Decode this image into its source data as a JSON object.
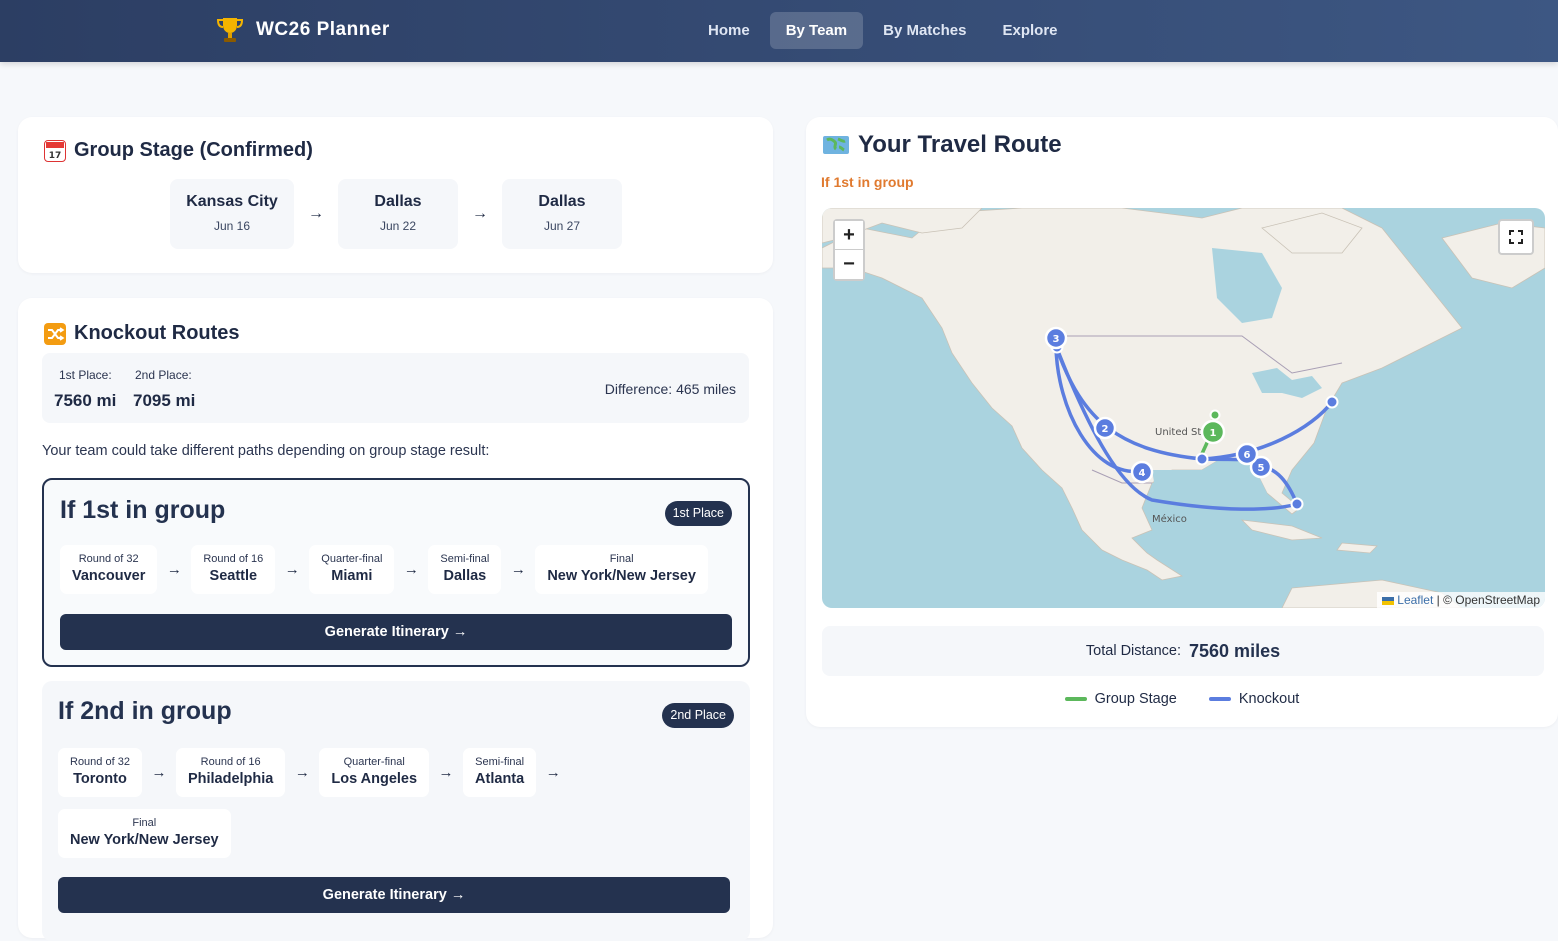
{
  "app": {
    "name": "WC26 Planner"
  },
  "nav": {
    "items": [
      "Home",
      "By Team",
      "By Matches",
      "Explore"
    ],
    "active": "By Team"
  },
  "group_stage": {
    "title": "Group Stage (Confirmed)",
    "venues": [
      {
        "city": "Kansas City",
        "date": "Jun 16"
      },
      {
        "city": "Dallas",
        "date": "Jun 22"
      },
      {
        "city": "Dallas",
        "date": "Jun 27"
      }
    ]
  },
  "knockout": {
    "title": "Knockout Routes",
    "first_label": "1st Place:",
    "first_value": "7560 mi",
    "second_label": "2nd Place:",
    "second_value": "7095 mi",
    "difference": "Difference: 465 miles",
    "intro": "Your team could take different paths depending on group stage result:",
    "routes": [
      {
        "title": "If 1st in group",
        "badge": "1st Place",
        "stages": [
          {
            "round": "Round of 32",
            "city": "Vancouver"
          },
          {
            "round": "Round of 16",
            "city": "Seattle"
          },
          {
            "round": "Quarter-final",
            "city": "Miami"
          },
          {
            "round": "Semi-final",
            "city": "Dallas"
          },
          {
            "round": "Final",
            "city": "New York/New Jersey"
          }
        ],
        "button": "Generate Itinerary →"
      },
      {
        "title": "If 2nd in group",
        "badge": "2nd Place",
        "stages": [
          {
            "round": "Round of 32",
            "city": "Toronto"
          },
          {
            "round": "Round of 16",
            "city": "Philadelphia"
          },
          {
            "round": "Quarter-final",
            "city": "Los Angeles"
          },
          {
            "round": "Semi-final",
            "city": "Atlanta"
          },
          {
            "round": "Final",
            "city": "New York/New Jersey"
          }
        ],
        "button": "Generate Itinerary →"
      }
    ]
  },
  "travel": {
    "title": "Your Travel Route",
    "subtitle": "If 1st in group",
    "map": {
      "zoom_in": "+",
      "zoom_out": "−",
      "labels": {
        "country_us": "United St",
        "country_mx": "México"
      },
      "markers": [
        "1",
        "2",
        "3",
        "4",
        "5",
        "6"
      ],
      "attribution_link": "Leaflet",
      "attribution_text": " | © OpenStreetMap"
    },
    "total_label": "Total Distance:",
    "total_value": "7560 miles",
    "legend": [
      {
        "label": "Group Stage",
        "color": "#5cb85c"
      },
      {
        "label": "Knockout",
        "color": "#5b7ddf"
      }
    ]
  }
}
